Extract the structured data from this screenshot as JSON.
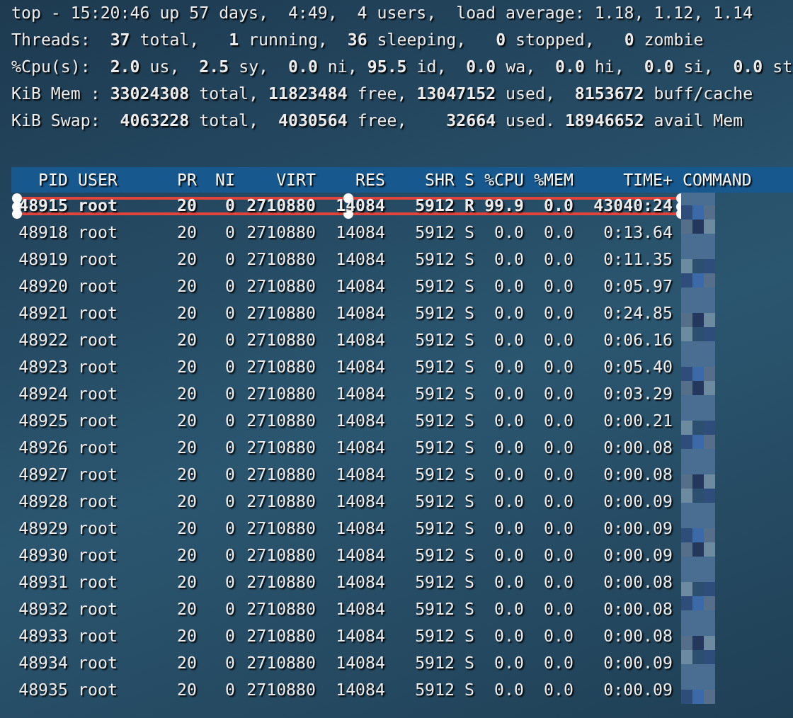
{
  "summary_lines": [
    "top - 15:20:46 up 57 days,  4:49,  4 users,  load average: 1.18, 1.12, 1.14",
    "Threads:  **37** total,   **1** running,  **36** sleeping,   **0** stopped,   **0** zombie",
    "%Cpu(s):  **2.0** us,  **2.5** sy,  **0.0** ni, **95.5** id,  **0.0** wa,  **0.0** hi,  **0.0** si,  **0.0** st",
    "KiB Mem : **33024308** total, **11823484** free, **13047152** used,  **8153672** buff/cache",
    "KiB Swap:  **4063228** total,  **4030564** free,    **32664** used. **18946652** avail Mem"
  ],
  "table": {
    "columns": [
      "PID",
      "USER",
      "PR",
      "NI",
      "VIRT",
      "RES",
      "SHR",
      "S",
      "%CPU",
      "%MEM",
      "TIME+",
      "COMMAND"
    ],
    "rows": [
      {
        "cells": [
          "48915",
          "root",
          "20",
          "0",
          "2710880",
          "14084",
          "5912",
          "R",
          "99.9",
          "0.0",
          "43040:24"
        ],
        "selected": true
      },
      {
        "cells": [
          "48918",
          "root",
          "20",
          "0",
          "2710880",
          "14084",
          "5912",
          "S",
          "0.0",
          "0.0",
          "0:13.64"
        ],
        "selected": false
      },
      {
        "cells": [
          "48919",
          "root",
          "20",
          "0",
          "2710880",
          "14084",
          "5912",
          "S",
          "0.0",
          "0.0",
          "0:11.35"
        ],
        "selected": false
      },
      {
        "cells": [
          "48920",
          "root",
          "20",
          "0",
          "2710880",
          "14084",
          "5912",
          "S",
          "0.0",
          "0.0",
          "0:05.97"
        ],
        "selected": false
      },
      {
        "cells": [
          "48921",
          "root",
          "20",
          "0",
          "2710880",
          "14084",
          "5912",
          "S",
          "0.0",
          "0.0",
          "0:24.85"
        ],
        "selected": false
      },
      {
        "cells": [
          "48922",
          "root",
          "20",
          "0",
          "2710880",
          "14084",
          "5912",
          "S",
          "0.0",
          "0.0",
          "0:06.16"
        ],
        "selected": false
      },
      {
        "cells": [
          "48923",
          "root",
          "20",
          "0",
          "2710880",
          "14084",
          "5912",
          "S",
          "0.0",
          "0.0",
          "0:05.40"
        ],
        "selected": false
      },
      {
        "cells": [
          "48924",
          "root",
          "20",
          "0",
          "2710880",
          "14084",
          "5912",
          "S",
          "0.0",
          "0.0",
          "0:03.29"
        ],
        "selected": false
      },
      {
        "cells": [
          "48925",
          "root",
          "20",
          "0",
          "2710880",
          "14084",
          "5912",
          "S",
          "0.0",
          "0.0",
          "0:00.21"
        ],
        "selected": false
      },
      {
        "cells": [
          "48926",
          "root",
          "20",
          "0",
          "2710880",
          "14084",
          "5912",
          "S",
          "0.0",
          "0.0",
          "0:00.08"
        ],
        "selected": false
      },
      {
        "cells": [
          "48927",
          "root",
          "20",
          "0",
          "2710880",
          "14084",
          "5912",
          "S",
          "0.0",
          "0.0",
          "0:00.08"
        ],
        "selected": false
      },
      {
        "cells": [
          "48928",
          "root",
          "20",
          "0",
          "2710880",
          "14084",
          "5912",
          "S",
          "0.0",
          "0.0",
          "0:00.09"
        ],
        "selected": false
      },
      {
        "cells": [
          "48929",
          "root",
          "20",
          "0",
          "2710880",
          "14084",
          "5912",
          "S",
          "0.0",
          "0.0",
          "0:00.09"
        ],
        "selected": false
      },
      {
        "cells": [
          "48930",
          "root",
          "20",
          "0",
          "2710880",
          "14084",
          "5912",
          "S",
          "0.0",
          "0.0",
          "0:00.09"
        ],
        "selected": false
      },
      {
        "cells": [
          "48931",
          "root",
          "20",
          "0",
          "2710880",
          "14084",
          "5912",
          "S",
          "0.0",
          "0.0",
          "0:00.08"
        ],
        "selected": false
      },
      {
        "cells": [
          "48932",
          "root",
          "20",
          "0",
          "2710880",
          "14084",
          "5912",
          "S",
          "0.0",
          "0.0",
          "0:00.08"
        ],
        "selected": false
      },
      {
        "cells": [
          "48933",
          "root",
          "20",
          "0",
          "2710880",
          "14084",
          "5912",
          "S",
          "0.0",
          "0.0",
          "0:00.08"
        ],
        "selected": false
      },
      {
        "cells": [
          "48934",
          "root",
          "20",
          "0",
          "2710880",
          "14084",
          "5912",
          "S",
          "0.0",
          "0.0",
          "0:00.09"
        ],
        "selected": false
      },
      {
        "cells": [
          "48935",
          "root",
          "20",
          "0",
          "2710880",
          "14084",
          "5912",
          "S",
          "0.0",
          "0.0",
          "0:00.09"
        ],
        "selected": false
      }
    ]
  }
}
